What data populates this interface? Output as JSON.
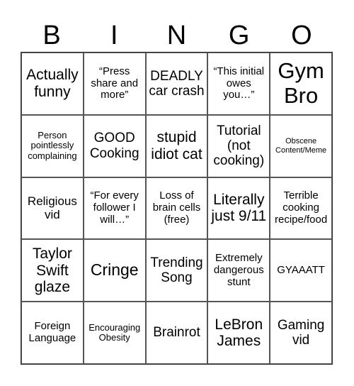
{
  "title_letters": [
    "B",
    "I",
    "N",
    "G",
    "O"
  ],
  "cells": [
    [
      "Actually funny",
      "“Press share and more”",
      "DEADLY car crash",
      "“This initial owes you…”",
      "Gym Bro"
    ],
    [
      "Person pointlessly complaining",
      "GOOD Cooking",
      "stupid idiot cat",
      "Tutorial (not cooking)",
      "Obscene Content/Meme"
    ],
    [
      "Religious vid",
      "“For every follower I will…”",
      "Loss of brain cells (free)",
      "Literally just 9/11",
      "Terrible cooking recipe/food"
    ],
    [
      "Taylor Swift glaze",
      "Cringe",
      "Trending Song",
      "Extremely dangerous stunt",
      "GYAAATT"
    ],
    [
      "Foreign Language",
      "Encouraging Obesity",
      "Brainrot",
      "LeBron James",
      "Gaming vid"
    ]
  ]
}
